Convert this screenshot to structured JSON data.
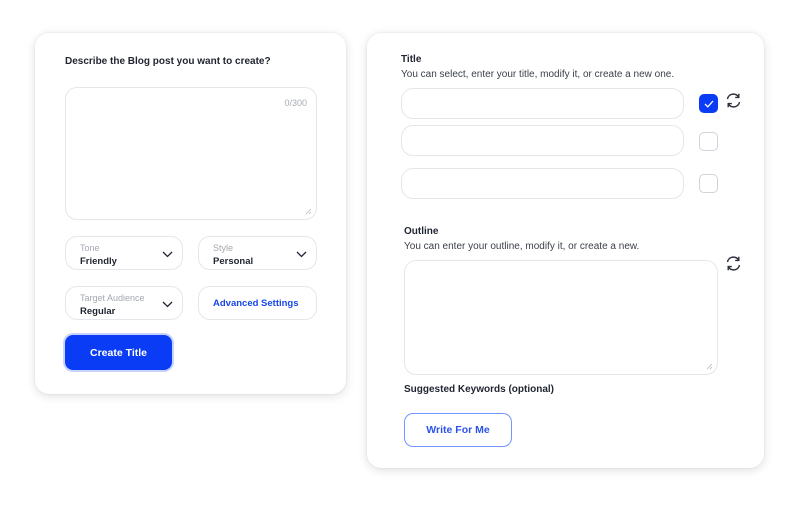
{
  "left": {
    "prompt_label": "Describe the Blog post you want to create?",
    "counter": "0/300",
    "tone": {
      "label": "Tone",
      "value": "Friendly"
    },
    "style": {
      "label": "Style",
      "value": "Personal"
    },
    "audience": {
      "label": "Target Audience",
      "value": "Regular"
    },
    "advanced_label": "Advanced Settings",
    "create_button": "Create Title"
  },
  "right": {
    "title_heading": "Title",
    "title_sub": "You can select, enter your title, modify it, or create a new one.",
    "titles_checked": [
      true,
      false,
      false
    ],
    "outline_heading": "Outline",
    "outline_sub": "You can enter your outline, modify it, or create a new.",
    "keywords_heading": "Suggested Keywords (optional)",
    "write_button": "Write For Me"
  },
  "colors": {
    "accent": "#0b3cf5",
    "link": "#1847e8"
  },
  "icons": [
    "chevron-down-icon",
    "refresh-icon",
    "check-icon",
    "resize-handle-icon"
  ]
}
